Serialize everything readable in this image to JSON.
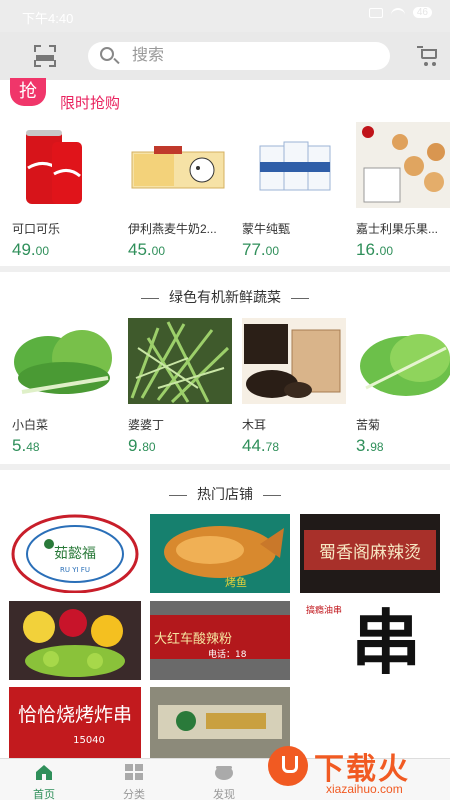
{
  "status_bar": {
    "time": "下午4:40",
    "battery": "46"
  },
  "search": {
    "placeholder": "搜索"
  },
  "flash_sale": {
    "badge": "抢",
    "title": "限时抢购",
    "products": [
      {
        "name": "可口可乐",
        "price_int": "49.",
        "price_dec": "00"
      },
      {
        "name": "伊利燕麦牛奶2...",
        "price_int": "45.",
        "price_dec": "00"
      },
      {
        "name": "蒙牛纯甄",
        "price_int": "77.",
        "price_dec": "00"
      },
      {
        "name": "嘉士利果乐果...",
        "price_int": "16.",
        "price_dec": "00"
      }
    ]
  },
  "vegetables": {
    "title": "绿色有机新鲜蔬菜",
    "products": [
      {
        "name": "小白菜",
        "price_int": "5.",
        "price_dec": "48"
      },
      {
        "name": "婆婆丁",
        "price_int": "9.",
        "price_dec": "80"
      },
      {
        "name": "木耳",
        "price_int": "44.",
        "price_dec": "78"
      },
      {
        "name": "苦菊",
        "price_int": "3.",
        "price_dec": "98"
      }
    ]
  },
  "shops": {
    "title": "热门店铺",
    "logos": {
      "ruyifu": "茹懿福",
      "ruyifu_pinyin": "RU YI FU",
      "fish": "烤鱼",
      "mala": "蜀香阁麻辣烫",
      "suanlafen": "大红车酸辣粉",
      "suanlafen_phone": "电话：18",
      "chuan": "串",
      "chuan_side": "搞瘾油串",
      "bbq": "恰恰烧烤炸串",
      "bbq_phone": "15040"
    }
  },
  "bottom_nav": {
    "items": [
      {
        "label": "首页"
      },
      {
        "label": "分类"
      },
      {
        "label": "发现"
      }
    ]
  },
  "watermark": {
    "brand": "下载火",
    "url": "xiazaihuo.com"
  },
  "colors": {
    "accent": "#2f8f5a",
    "flash": "#e9235f"
  }
}
